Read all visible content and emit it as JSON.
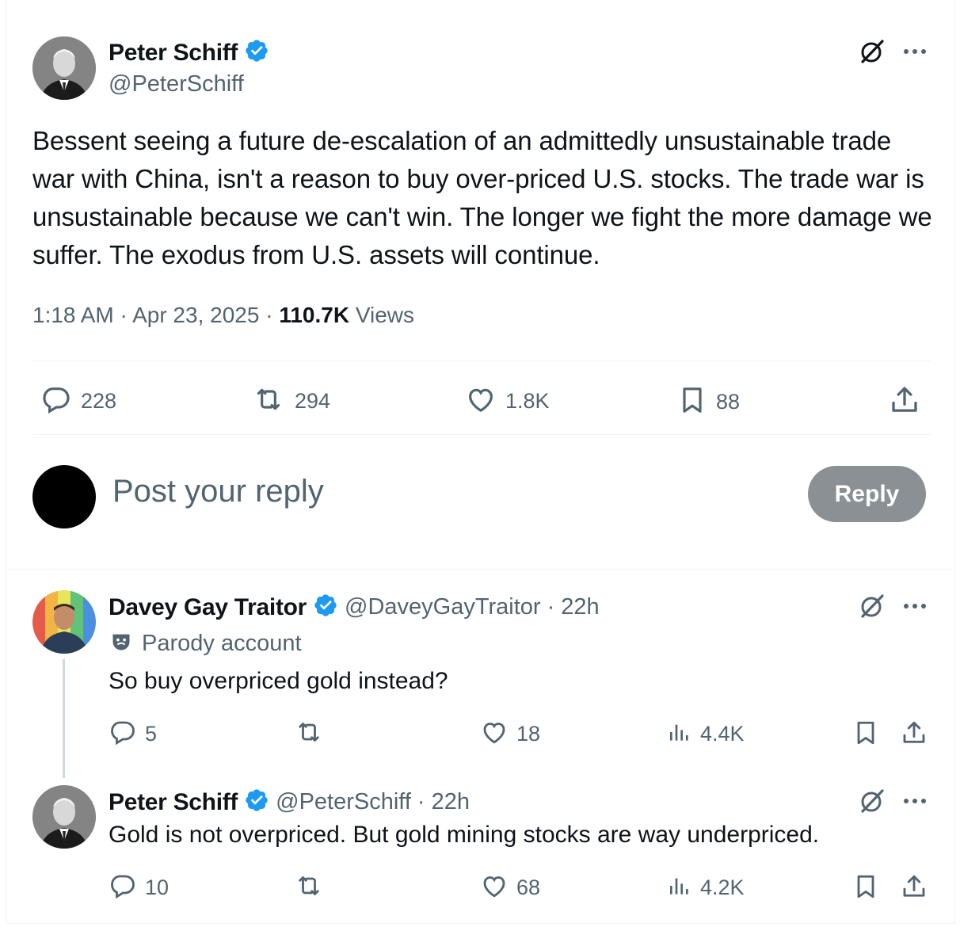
{
  "main_post": {
    "author_name": "Peter Schiff",
    "author_handle": "@PeterSchiff",
    "text": "Bessent seeing a future de-escalation of an admittedly unsustainable trade war with China, isn't a reason to buy over-priced U.S. stocks. The trade war is unsustainable because we can't win. The longer we fight the more damage we suffer. The exodus from U.S. assets will continue.",
    "time": "1:18 AM",
    "date": "Apr 23, 2025",
    "views_count": "110.7K",
    "views_label": "Views",
    "separator": "·",
    "replies": "228",
    "reposts": "294",
    "likes": "1.8K",
    "bookmarks": "88"
  },
  "composer": {
    "placeholder": "Post your reply",
    "button_label": "Reply"
  },
  "replies": [
    {
      "author_name": "Davey Gay Traitor",
      "author_handle": "@DaveyGayTraitor",
      "time": "22h",
      "badge_label": "Parody account",
      "text": "So buy overpriced gold instead?",
      "replies": "5",
      "likes": "18",
      "views": "4.4K"
    },
    {
      "author_name": "Peter Schiff",
      "author_handle": "@PeterSchiff",
      "time": "22h",
      "text": "Gold is not overpriced. But gold mining stocks are way underpriced.",
      "replies": "10",
      "likes": "68",
      "views": "4.2K"
    }
  ],
  "colors": {
    "verified": "#1d9bf0",
    "muted": "#536471",
    "reply_button": "#8b9094"
  },
  "icons": [
    "verified-badge-icon",
    "grok-icon",
    "more-icon",
    "reply-icon",
    "repost-icon",
    "like-icon",
    "bookmark-icon",
    "share-icon",
    "views-icon",
    "parody-mask-icon"
  ]
}
